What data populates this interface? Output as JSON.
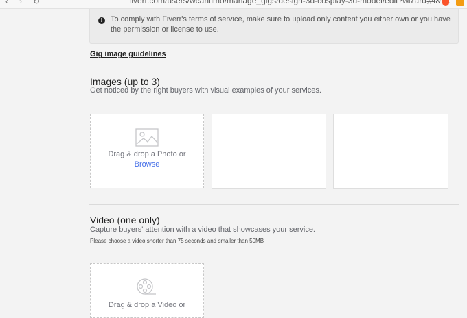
{
  "browser": {
    "url_text": "fiverr.com/users/wcantimo/manage_gigs/design-3d-cosplay-3d-model/edit?wizard=4&t..."
  },
  "notice": {
    "text": "To comply with Fiverr's terms of service, make sure to upload only content you either own or you have the permission or license to use."
  },
  "guidelines_link": "Gig image guidelines",
  "images": {
    "title": "Images (up to 3)",
    "subtitle": "Get noticed by the right buyers with visual examples of your services.",
    "drop_text": "Drag & drop a Photo or",
    "browse_label": "Browse"
  },
  "video": {
    "title": "Video (one only)",
    "subtitle": "Capture buyers' attention with a video that showcases your service.",
    "note": "Please choose a video shorter than 75 seconds and smaller than 50MB",
    "drop_text": "Drag & drop a Video or"
  },
  "colors": {
    "link_blue": "#446ee7",
    "page_bg": "#f3f3f3",
    "notice_bg": "#ebebeb"
  }
}
